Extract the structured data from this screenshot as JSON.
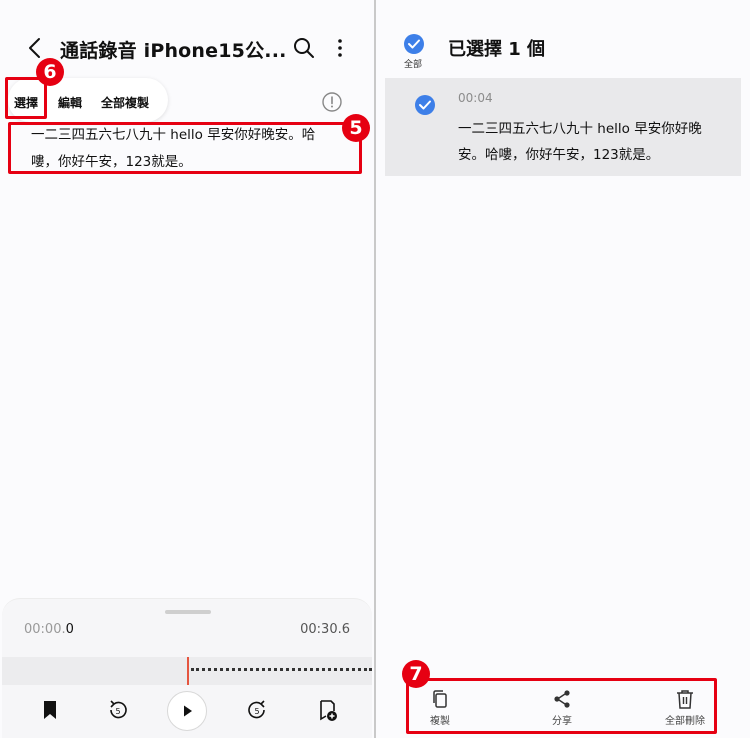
{
  "left": {
    "title": "通話錄音 iPhone15公...",
    "toolbar": {
      "select": "選擇",
      "edit": "編輯",
      "copy_all": "全部複製"
    },
    "transcript": "一二三四五六七八九十 hello 早安你好晚安。哈嘍，你好午安，123就是。",
    "player": {
      "time_start_dim": "00:00.",
      "time_start_bold": "0",
      "time_end": "00:30.6",
      "rewind_seconds": "5",
      "forward_seconds": "5"
    }
  },
  "right": {
    "all_label": "全部",
    "title": "已選擇 1 個",
    "entry": {
      "time": "00:04",
      "text": "一二三四五六七八九十 hello 早安你好晚安。哈嘍，你好午安，123就是。"
    },
    "actions": {
      "copy": "複製",
      "share": "分享",
      "delete_all": "全部刪除"
    }
  },
  "annotations": {
    "badge5": "5",
    "badge6": "6",
    "badge7": "7"
  },
  "colors": {
    "accent_blue": "#3d7fe8",
    "highlight_red": "#e60012",
    "playhead": "#e5553f"
  }
}
